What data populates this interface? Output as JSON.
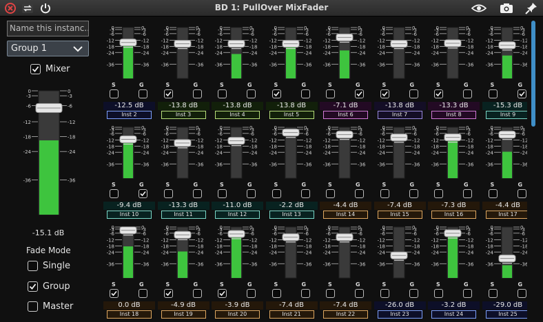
{
  "window": {
    "title": "BD 1: PullOver MixFader"
  },
  "left_panel": {
    "instance_name_placeholder": "Name this instanc...",
    "group_value": "Group 1",
    "mixer_label": "Mixer",
    "mixer_checked": true,
    "master_db": "-15.1 dB",
    "master_fill": 0.6,
    "fade_mode_label": "Fade Mode",
    "fade_modes": [
      {
        "label": "Single",
        "checked": false
      },
      {
        "label": "Group",
        "checked": true
      },
      {
        "label": "Master",
        "checked": false
      }
    ]
  },
  "scale_labels": [
    "0",
    "-3",
    "-6",
    "-12",
    "-18",
    "-24",
    "-36"
  ],
  "strips": [
    {
      "name": "Inst 2",
      "db": "-12.5 dB",
      "level": 0.65,
      "s": false,
      "g": false,
      "color": "#7da0ff",
      "bg": "#0d0f28"
    },
    {
      "name": "Inst 3",
      "db": "-13.8 dB",
      "level": 0.0,
      "s": true,
      "g": false,
      "color": "#b8e07a",
      "bg": "#12200a"
    },
    {
      "name": "Inst 4",
      "db": "-13.8 dB",
      "level": 0.48,
      "s": false,
      "g": false,
      "color": "#b8e07a",
      "bg": "#12200a"
    },
    {
      "name": "Inst 5",
      "db": "-13.8 dB",
      "level": 0.62,
      "s": true,
      "g": false,
      "color": "#b8e07a",
      "bg": "#12200a"
    },
    {
      "name": "Inst 6",
      "db": "-7.1 dB",
      "level": 0.55,
      "s": false,
      "g": true,
      "color": "#d27ad8",
      "bg": "#230a24"
    },
    {
      "name": "Inst 7",
      "db": "-13.8 dB",
      "level": 0.0,
      "s": true,
      "g": false,
      "color": "#9a8ae0",
      "bg": "#140e26"
    },
    {
      "name": "Inst 8",
      "db": "-13.3 dB",
      "level": 0.0,
      "s": true,
      "g": false,
      "color": "#d27ad8",
      "bg": "#230a24"
    },
    {
      "name": "Inst 9",
      "db": "-15.3 dB",
      "level": 0.45,
      "s": false,
      "g": true,
      "color": "#7ad8c8",
      "bg": "#082220"
    },
    {
      "name": "Inst 10",
      "db": "-9.4 dB",
      "level": 0.72,
      "s": false,
      "g": true,
      "color": "#7ad8c8",
      "bg": "#082220"
    },
    {
      "name": "Inst 11",
      "db": "-13.3 dB",
      "level": 0.0,
      "s": false,
      "g": false,
      "color": "#7ad8c8",
      "bg": "#082220"
    },
    {
      "name": "Inst 12",
      "db": "-11.0 dB",
      "level": 0.0,
      "s": false,
      "g": false,
      "color": "#7ad8c8",
      "bg": "#082220"
    },
    {
      "name": "Inst 13",
      "db": "-2.2 dB",
      "level": 0.0,
      "s": false,
      "g": false,
      "color": "#7ad8c8",
      "bg": "#082220"
    },
    {
      "name": "Inst 14",
      "db": "-4.4 dB",
      "level": 0.0,
      "s": false,
      "g": false,
      "color": "#e0a860",
      "bg": "#24180a"
    },
    {
      "name": "Inst 15",
      "db": "-7.4 dB",
      "level": 0.0,
      "s": false,
      "g": false,
      "color": "#e0a860",
      "bg": "#24180a"
    },
    {
      "name": "Inst 16",
      "db": "-7.3 dB",
      "level": 0.82,
      "s": false,
      "g": false,
      "color": "#e0a860",
      "bg": "#24180a"
    },
    {
      "name": "Inst 17",
      "db": "-4.4 dB",
      "level": 0.52,
      "s": false,
      "g": false,
      "color": "#e0a860",
      "bg": "#24180a"
    },
    {
      "name": "Inst 18",
      "db": "0.0 dB",
      "level": 0.62,
      "s": true,
      "g": false,
      "color": "#e0a860",
      "bg": "#24180a"
    },
    {
      "name": "Inst 19",
      "db": "-4.9 dB",
      "level": 0.52,
      "s": true,
      "g": false,
      "color": "#e0a860",
      "bg": "#24180a"
    },
    {
      "name": "Inst 20",
      "db": "-3.9 dB",
      "level": 0.82,
      "s": true,
      "g": false,
      "color": "#e0a860",
      "bg": "#24180a"
    },
    {
      "name": "Inst 21",
      "db": "-7.4 dB",
      "level": 0.0,
      "s": false,
      "g": false,
      "color": "#e0a860",
      "bg": "#24180a"
    },
    {
      "name": "Inst 22",
      "db": "-7.4 dB",
      "level": 0.0,
      "s": false,
      "g": false,
      "color": "#e0a860",
      "bg": "#24180a"
    },
    {
      "name": "Inst 23",
      "db": "-26.0 dB",
      "level": 0.0,
      "s": false,
      "g": false,
      "color": "#7da0ff",
      "bg": "#0d0f28"
    },
    {
      "name": "Inst 24",
      "db": "-3.2 dB",
      "level": 0.88,
      "s": false,
      "g": false,
      "color": "#7da0ff",
      "bg": "#0d0f28"
    },
    {
      "name": "Inst 25",
      "db": "-29.0 dB",
      "level": 0.25,
      "s": false,
      "g": false,
      "color": "#7da0ff",
      "bg": "#0d0f28"
    }
  ],
  "strip_labels": {
    "solo": "S",
    "group": "G"
  },
  "colors": {
    "meter_green": "#3ec43e",
    "scroll_accent": "#3f8fc7"
  }
}
